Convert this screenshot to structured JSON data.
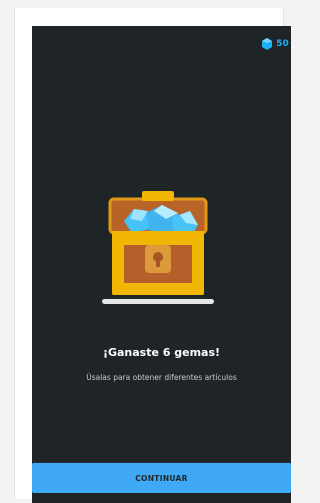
{
  "header": {
    "gem_count": "50",
    "gem_icon": "gem-icon"
  },
  "main": {
    "illustration": "treasure-chest-icon",
    "title": "¡Ganaste 6 gemas!",
    "subtitle": "Úsalas para obtener diferentes artículos"
  },
  "footer": {
    "continue_label": "CONTINUAR"
  },
  "colors": {
    "background": "#1f2527",
    "accent": "#3fa9f5",
    "gem": "#1cb0f6",
    "chest_gold": "#f2b705",
    "chest_wood": "#c0682c"
  }
}
